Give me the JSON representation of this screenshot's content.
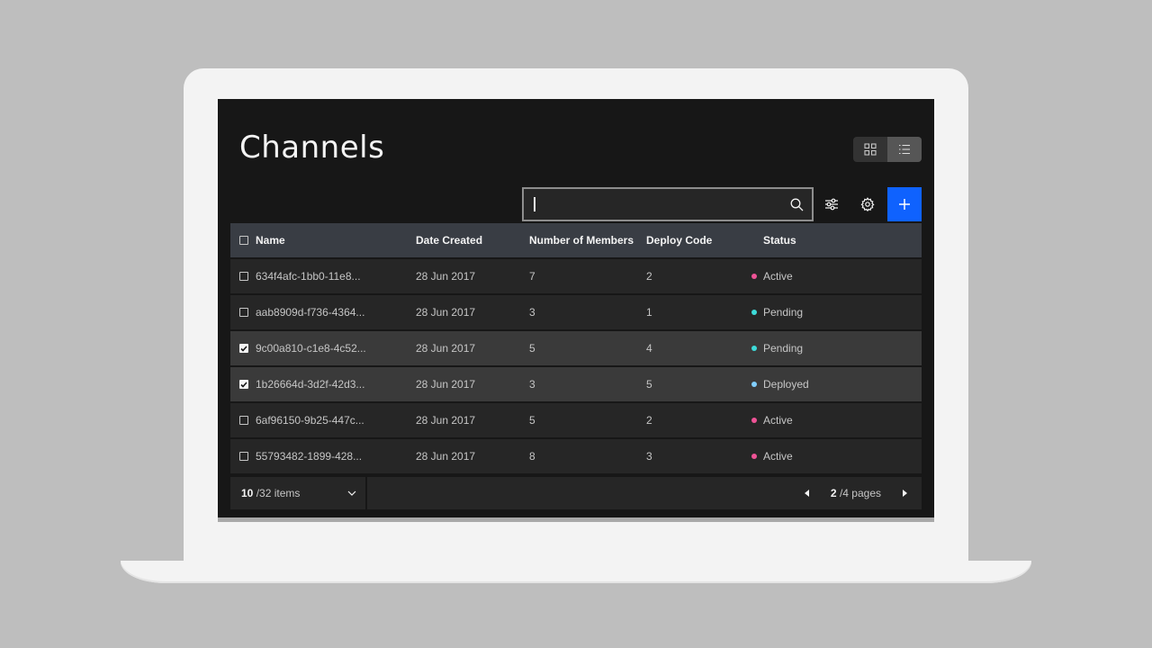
{
  "page": {
    "title": "Channels"
  },
  "toolbar": {
    "search_value": "",
    "search_placeholder": ""
  },
  "table": {
    "headers": [
      "Name",
      "Date Created",
      "Number of Members",
      "Deploy Code",
      "Status"
    ],
    "rows": [
      {
        "name": "634f4afc-1bb0-11e8...",
        "date": "28 Jun 2017",
        "members": "7",
        "deploy": "2",
        "status": "Active",
        "status_color": "#ee5396",
        "checked": false
      },
      {
        "name": "aab8909d-f736-4364...",
        "date": "28 Jun 2017",
        "members": "3",
        "deploy": "1",
        "status": "Pending",
        "status_color": "#3ddbd9",
        "checked": false
      },
      {
        "name": "9c00a810-c1e8-4c52...",
        "date": "28 Jun 2017",
        "members": "5",
        "deploy": "4",
        "status": "Pending",
        "status_color": "#3ddbd9",
        "checked": true
      },
      {
        "name": "1b26664d-3d2f-42d3...",
        "date": "28 Jun 2017",
        "members": "3",
        "deploy": "5",
        "status": "Deployed",
        "status_color": "#82cfff",
        "checked": true
      },
      {
        "name": "6af96150-9b25-447c...",
        "date": "28 Jun 2017",
        "members": "5",
        "deploy": "2",
        "status": "Active",
        "status_color": "#ee5396",
        "checked": false
      },
      {
        "name": "55793482-1899-428...",
        "date": "28 Jun 2017",
        "members": "8",
        "deploy": "3",
        "status": "Active",
        "status_color": "#ee5396",
        "checked": false
      }
    ]
  },
  "pagination": {
    "per_page": "10",
    "total_items": "/32 items",
    "current_page": "2",
    "total_pages": "/4 pages"
  },
  "colors": {
    "accent": "#0f62fe",
    "background": "#171717"
  }
}
